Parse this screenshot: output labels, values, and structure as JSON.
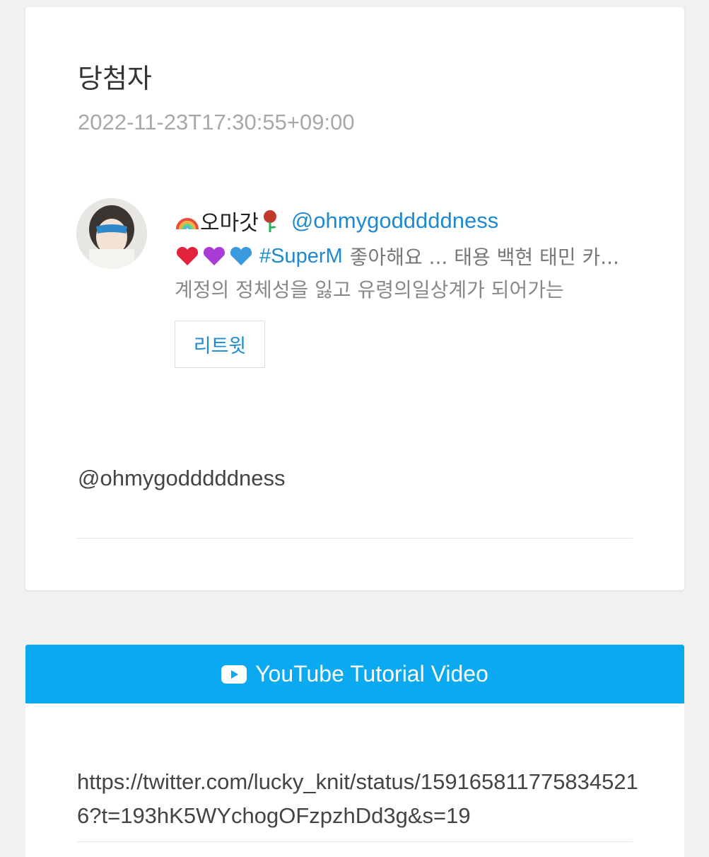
{
  "winner_card": {
    "title": "당첨자",
    "timestamp": "2022-11-23T17:30:55+09:00",
    "profile": {
      "display_name": "오마갓",
      "name_prefix_emoji": "rainbow-emoji",
      "name_suffix_emoji": "rose-emoji",
      "handle": "@ohmygodddddness",
      "bio_emojis": [
        "red-heart",
        "purple-heart",
        "blue-heart"
      ],
      "hashtag": "#SuperM",
      "bio_line1_rest": "좋아해요 ... 태용 백현 태민 카...",
      "bio_line2": "계정의 정체성을 잃고 유령의일상계가 되어가는"
    },
    "retweet_label": "리트윗",
    "mention": "@ohmygodddddness"
  },
  "youtube_card": {
    "header_label": "YouTube Tutorial Video",
    "link": "https://twitter.com/lucky_knit/status/1591658117758345216?t=193hK5WYchogOFzpzhDd3g&s=19"
  },
  "colors": {
    "link_blue": "#1d8ad0",
    "youtube_header": "#0ba9f0",
    "background": "#f1f1f1"
  }
}
